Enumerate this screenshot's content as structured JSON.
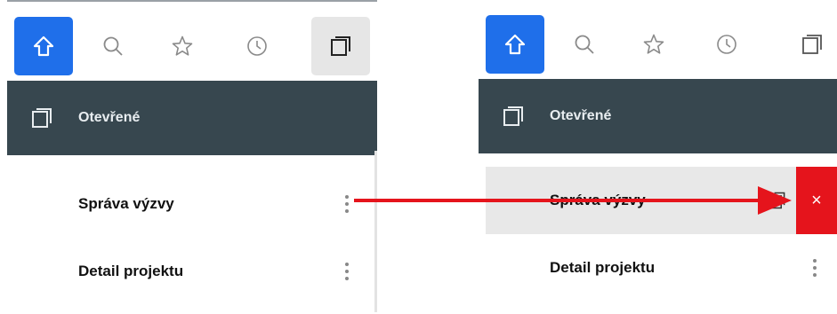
{
  "panels": {
    "left": {
      "header_label": "Otevřené",
      "items": [
        {
          "label": "Správa výzvy"
        },
        {
          "label": "Detail projektu"
        }
      ]
    },
    "right": {
      "header_label": "Otevřené",
      "items": [
        {
          "label": "Správa výzvy"
        },
        {
          "label": "Detail projektu"
        }
      ],
      "close_label": "×"
    }
  },
  "icons": {
    "home": "home-icon",
    "search": "search-icon",
    "favorites": "star-icon",
    "history": "clock-icon",
    "open": "windows-icon",
    "menu": "kebab-icon",
    "copy": "copy-icon",
    "close": "close-icon"
  },
  "colors": {
    "accent": "#1f6fea",
    "header_bg": "#37474f",
    "header_text": "#e8edf0",
    "highlight_bg": "#e8e8e8",
    "danger": "#e5141c",
    "annotation_arrow": "#e5141c"
  }
}
